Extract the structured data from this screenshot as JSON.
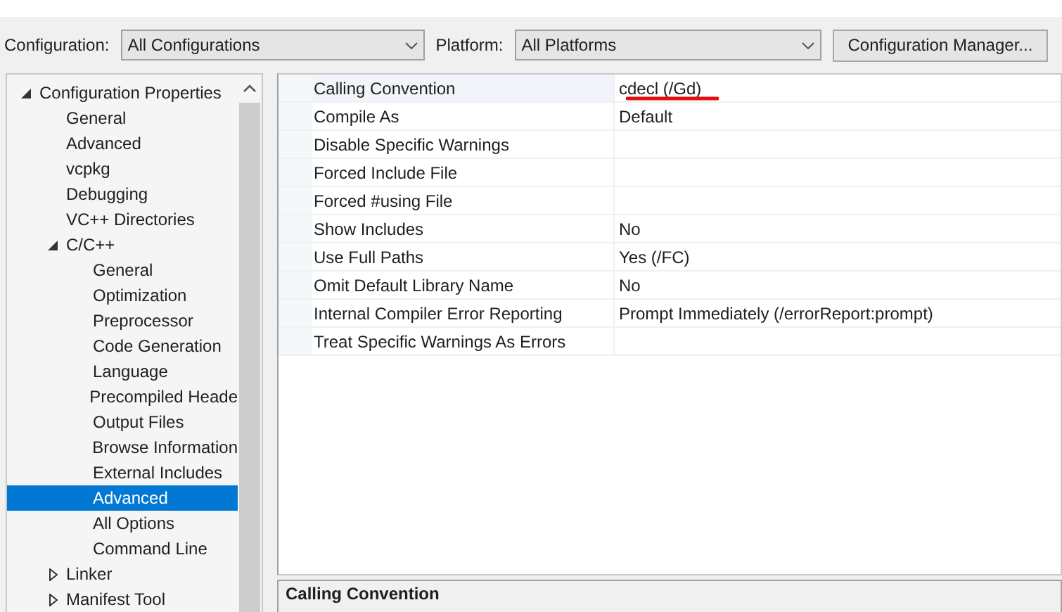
{
  "toolbar": {
    "configuration_label": "Configuration:",
    "configuration_value": "All Configurations",
    "platform_label": "Platform:",
    "platform_value": "All Platforms",
    "manager_button": "Configuration Manager..."
  },
  "tree": [
    {
      "label": "Configuration Properties",
      "expanded": true,
      "selected": false,
      "children": [
        {
          "label": "General",
          "selected": false
        },
        {
          "label": "Advanced",
          "selected": false
        },
        {
          "label": "vcpkg",
          "selected": false
        },
        {
          "label": "Debugging",
          "selected": false
        },
        {
          "label": "VC++ Directories",
          "selected": false
        },
        {
          "label": "C/C++",
          "expanded": true,
          "selected": false,
          "children": [
            {
              "label": "General",
              "selected": false
            },
            {
              "label": "Optimization",
              "selected": false
            },
            {
              "label": "Preprocessor",
              "selected": false
            },
            {
              "label": "Code Generation",
              "selected": false
            },
            {
              "label": "Language",
              "selected": false
            },
            {
              "label": "Precompiled Heade",
              "selected": false
            },
            {
              "label": "Output Files",
              "selected": false
            },
            {
              "label": "Browse Information",
              "selected": false
            },
            {
              "label": "External Includes",
              "selected": false
            },
            {
              "label": "Advanced",
              "selected": true
            },
            {
              "label": "All Options",
              "selected": false
            },
            {
              "label": "Command Line",
              "selected": false
            }
          ]
        },
        {
          "label": "Linker",
          "expanded": false,
          "selected": false
        },
        {
          "label": "Manifest Tool",
          "expanded": false,
          "selected": false
        }
      ]
    }
  ],
  "properties": [
    {
      "name": "Calling Convention",
      "value": "cdecl (/Gd)",
      "selected": true,
      "annotated": true
    },
    {
      "name": "Compile As",
      "value": "Default",
      "selected": false,
      "annotated": false
    },
    {
      "name": "Disable Specific Warnings",
      "selected": false,
      "annotated": false
    },
    {
      "name": "Forced Include File",
      "selected": false,
      "annotated": false
    },
    {
      "name": "Forced #using File",
      "selected": false,
      "annotated": false
    },
    {
      "name": "Show Includes",
      "value": "No",
      "selected": false,
      "annotated": false
    },
    {
      "name": "Use Full Paths",
      "value": "Yes (/FC)",
      "selected": false,
      "annotated": false
    },
    {
      "name": "Omit Default Library Name",
      "value": "No",
      "selected": false,
      "annotated": false
    },
    {
      "name": "Internal Compiler Error Reporting",
      "value": "Prompt Immediately (/errorReport:prompt)",
      "selected": false,
      "annotated": false
    },
    {
      "name": "Treat Specific Warnings As Errors",
      "selected": false,
      "annotated": false
    }
  ],
  "description": {
    "title": "Calling Convention"
  }
}
